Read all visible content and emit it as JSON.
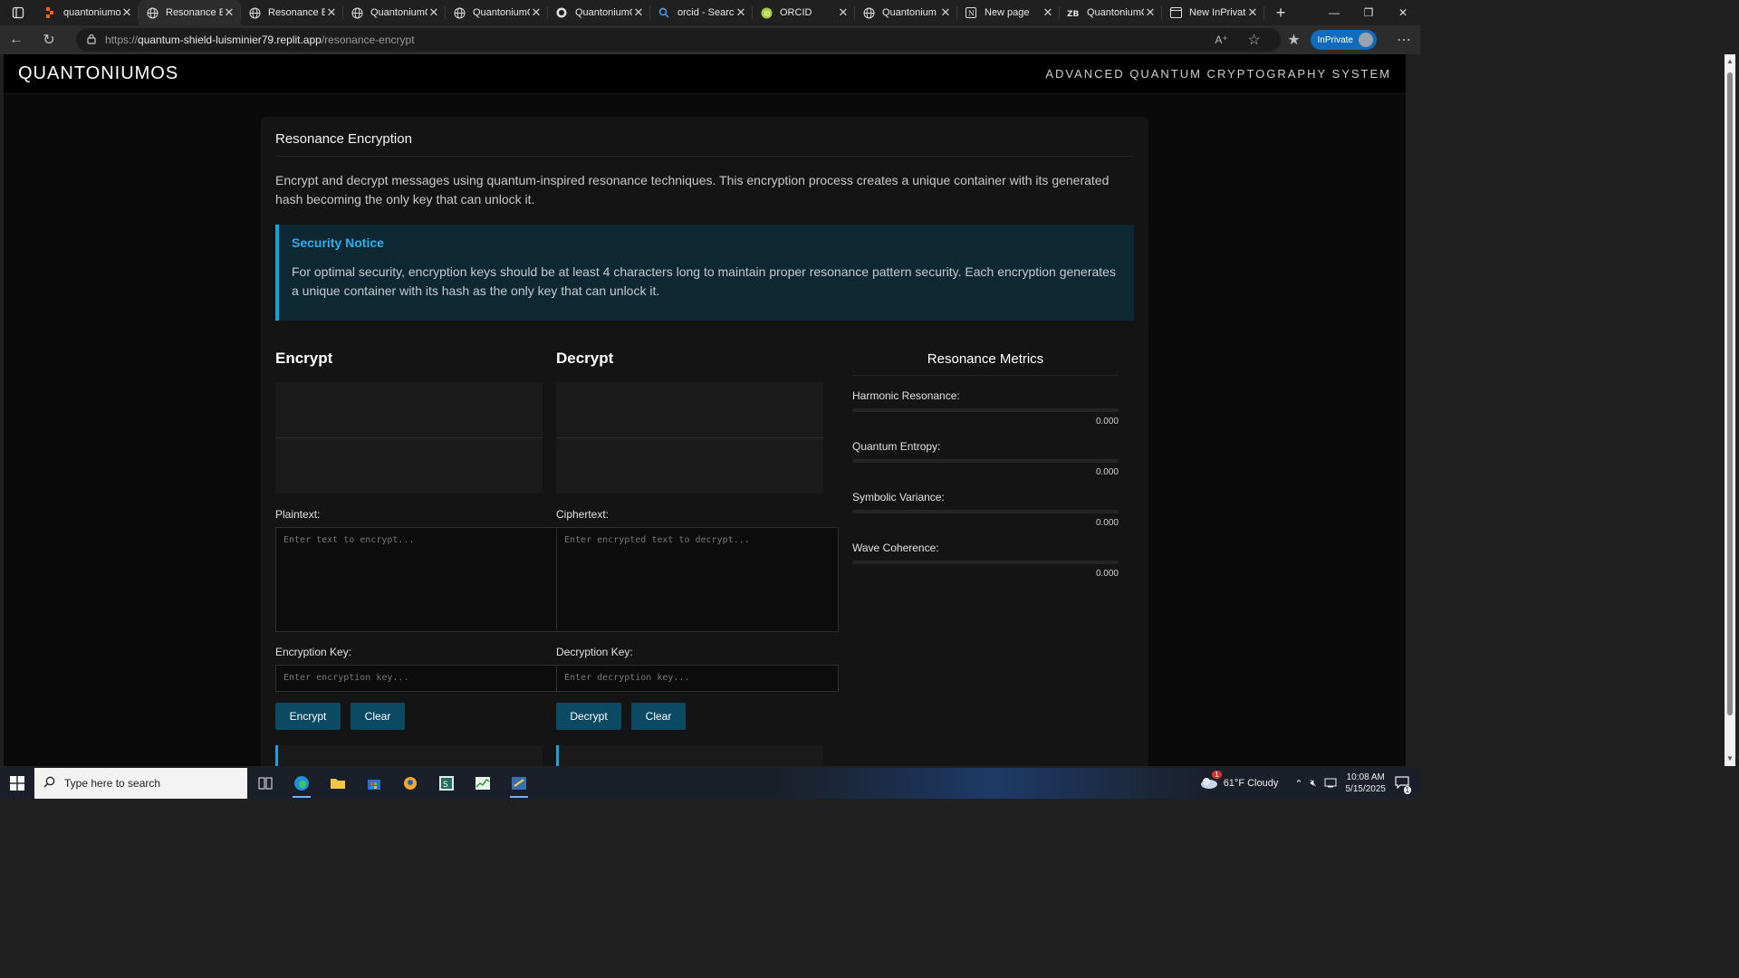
{
  "browser": {
    "tabs": [
      {
        "title": "quantoniumos",
        "active": false,
        "icon": "replit-icon"
      },
      {
        "title": "Resonance Enc",
        "active": true,
        "icon": "globe-icon"
      },
      {
        "title": "Resonance Enc",
        "active": false,
        "icon": "globe-icon"
      },
      {
        "title": "QuantoniumO",
        "active": false,
        "icon": "globe-icon"
      },
      {
        "title": "QuantoniumO",
        "active": false,
        "icon": "globe-icon"
      },
      {
        "title": "QuantoniumO",
        "active": false,
        "icon": "github-icon"
      },
      {
        "title": "orcid - Search",
        "active": false,
        "icon": "search-icon"
      },
      {
        "title": "ORCID",
        "active": false,
        "icon": "orcid-icon"
      },
      {
        "title": "Quantonium C",
        "active": false,
        "icon": "globe-icon"
      },
      {
        "title": "New page",
        "active": false,
        "icon": "notion-icon"
      },
      {
        "title": "QuantoniumO",
        "active": false,
        "icon": "zenodo-icon"
      },
      {
        "title": "New InPrivate",
        "active": false,
        "icon": "inprivate-tab-icon"
      }
    ],
    "url": {
      "scheme": "https://",
      "host": "quantum-shield-luisminier79.replit.app",
      "path": "/resonance-encrypt"
    },
    "inprivate_label": "InPrivate"
  },
  "header": {
    "brand": "QUANTONIUMOS",
    "tagline": "ADVANCED QUANTUM CRYPTOGRAPHY SYSTEM"
  },
  "card": {
    "title": "Resonance Encryption",
    "intro": "Encrypt and decrypt messages using quantum-inspired resonance techniques. This encryption process creates a unique container with its generated hash becoming the only key that can unlock it.",
    "notice": {
      "title": "Security Notice",
      "text": "For optimal security, encryption keys should be at least 4 characters long to maintain proper resonance pattern security. Each encryption generates a unique container with its hash as the only key that can unlock it."
    }
  },
  "encrypt": {
    "heading": "Encrypt",
    "plaintext_label": "Plaintext:",
    "plaintext_placeholder": "Enter text to encrypt...",
    "key_label": "Encryption Key:",
    "key_placeholder": "Enter encryption key...",
    "button": "Encrypt",
    "clear": "Clear"
  },
  "decrypt": {
    "heading": "Decrypt",
    "ciphertext_label": "Ciphertext:",
    "ciphertext_placeholder": "Enter encrypted text to decrypt...",
    "key_label": "Decryption Key:",
    "key_placeholder": "Enter decryption key...",
    "button": "Decrypt",
    "clear": "Clear"
  },
  "metrics": {
    "title": "Resonance Metrics",
    "items": [
      {
        "name": "Harmonic Resonance:",
        "value": "0.000",
        "level": 0
      },
      {
        "name": "Quantum Entropy:",
        "value": "0.000",
        "level": 0
      },
      {
        "name": "Symbolic Variance:",
        "value": "0.000",
        "level": 0
      },
      {
        "name": "Wave Coherence:",
        "value": "0.000",
        "level": 0
      }
    ]
  },
  "taskbar": {
    "search_placeholder": "Type here to search",
    "weather": "61°F  Cloudy",
    "weather_badge": "1",
    "time": "10:08 AM",
    "date": "5/15/2025",
    "notification_count": "1"
  },
  "colors": {
    "accent": "#1aa0dc",
    "button": "#0b4a62",
    "notice_bg": "#0d2733",
    "page_bg": "#0a0a0a",
    "card_bg": "#141414"
  }
}
